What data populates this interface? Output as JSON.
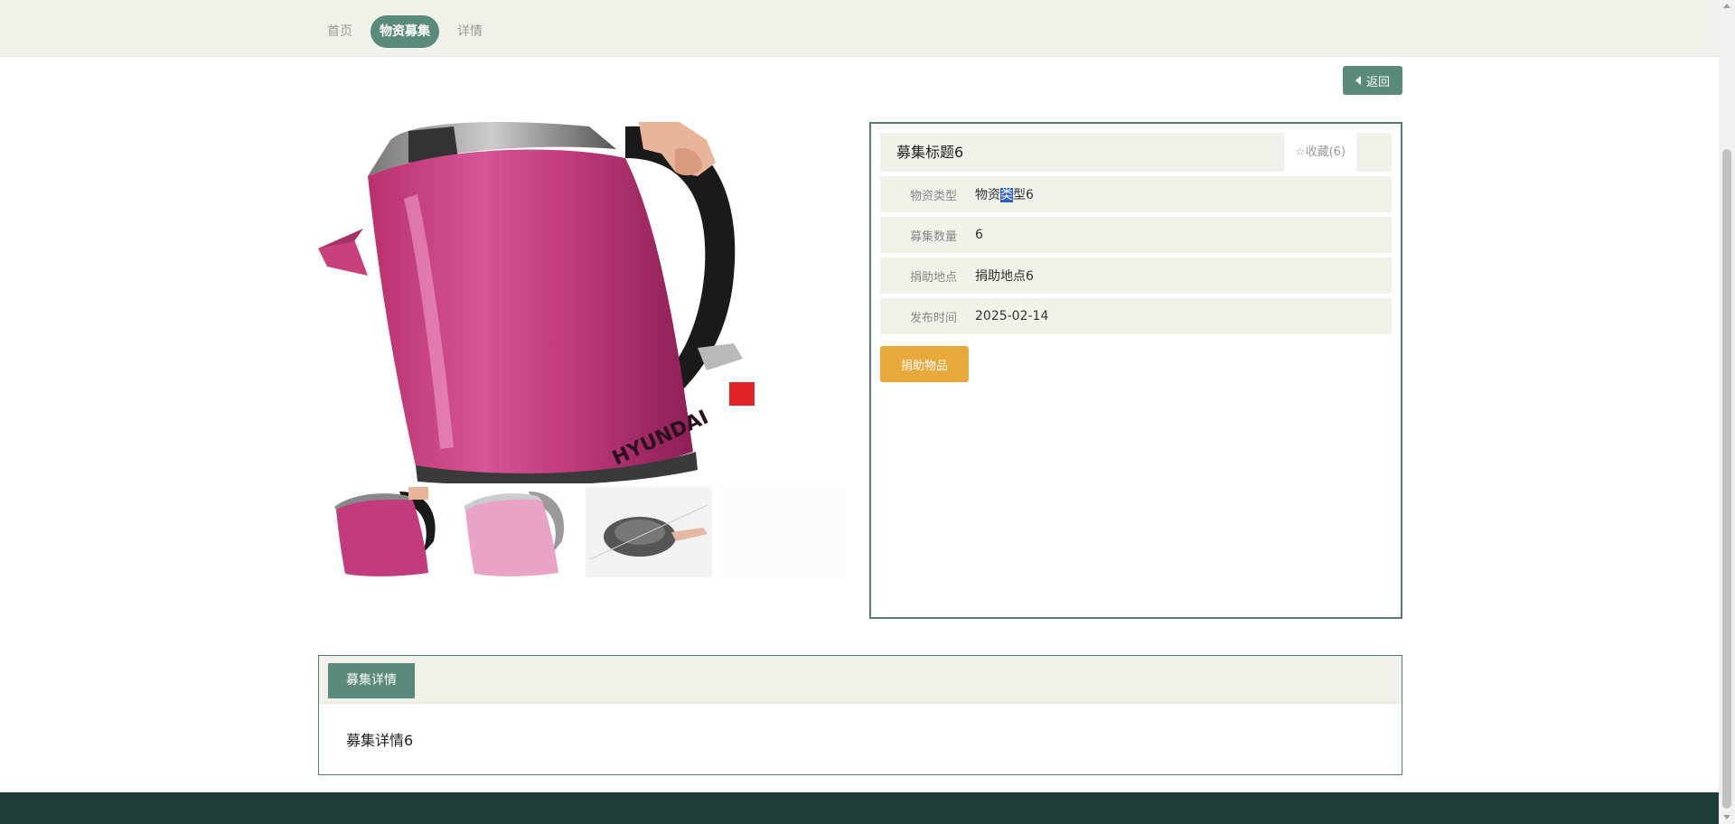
{
  "breadcrumb": {
    "items": [
      "首页",
      "物资募集",
      "详情"
    ]
  },
  "back_label": "返回",
  "title": "募集标题6",
  "favorite": {
    "label": "收藏(6)",
    "icon": "star-outline-icon"
  },
  "fields": [
    {
      "label": "物资类型",
      "value_a": "物资",
      "value_sel": "类",
      "value_b": "型6"
    },
    {
      "label": "募集数量",
      "value": "6"
    },
    {
      "label": "捐助地点",
      "value": "捐助地点6"
    },
    {
      "label": "发布时间",
      "value": "2025-02-14"
    }
  ],
  "donate_label": "捐助物品",
  "product": {
    "brand_text": "HYUNDAI"
  },
  "detail": {
    "tab_label": "募集详情",
    "content": "募集详情6"
  },
  "colors": {
    "accent": "#5a8a7c",
    "donate": "#e9a83c",
    "footer": "#1f3d36",
    "panel": "#f1f1ea"
  }
}
